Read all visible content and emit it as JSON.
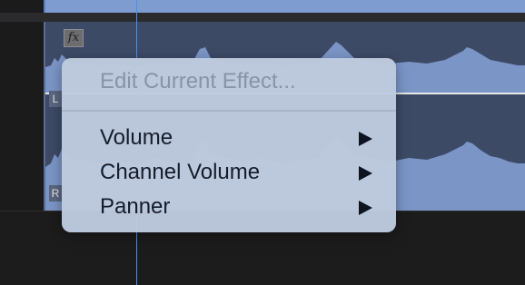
{
  "clip": {
    "fx_badge": "fx",
    "left_channel_label": "L",
    "right_channel_label": "R"
  },
  "context_menu": {
    "items": [
      {
        "label": "Edit Current Effect...",
        "enabled": false,
        "has_submenu": false
      },
      {
        "label": "Volume",
        "enabled": true,
        "has_submenu": true
      },
      {
        "label": "Channel Volume",
        "enabled": true,
        "has_submenu": true
      },
      {
        "label": "Panner",
        "enabled": true,
        "has_submenu": true
      }
    ]
  },
  "colors": {
    "accent_playhead": "#4a8ff0",
    "waveform": "#7b95c6",
    "clip_background": "#3d4a66",
    "menu_background": "#becade"
  },
  "icons": {
    "submenu_arrow": "triangle-right"
  }
}
